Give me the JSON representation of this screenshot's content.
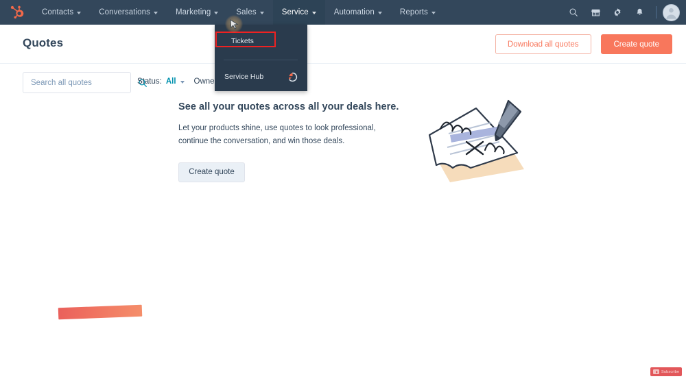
{
  "topnav": {
    "logo_name": "hubspot-sprocket-logo",
    "items": [
      {
        "label": "Contacts",
        "has_caret": true,
        "active": false
      },
      {
        "label": "Conversations",
        "has_caret": true,
        "active": false
      },
      {
        "label": "Marketing",
        "has_caret": true,
        "active": false
      },
      {
        "label": "Sales",
        "has_caret": true,
        "active": false
      },
      {
        "label": "Service",
        "has_caret": true,
        "active": true
      },
      {
        "label": "Automation",
        "has_caret": true,
        "active": false
      },
      {
        "label": "Reports",
        "has_caret": true,
        "active": false
      }
    ],
    "icons": [
      "search-icon",
      "marketplace-icon",
      "settings-gear-icon",
      "notifications-bell-icon"
    ],
    "avatar_name": "user-avatar",
    "background_color": "#33475b",
    "active_background_color": "#2d4356"
  },
  "dropdown": {
    "open_for": "Service",
    "tickets_label": "Tickets",
    "service_hub_label": "Service Hub",
    "service_hub_icon": "service-hub-icon",
    "highlight_color": "#ee2222",
    "background_color": "#2a3b4d"
  },
  "header": {
    "title": "Quotes",
    "download_label": "Download all quotes",
    "create_label": "Create quote",
    "primary_color": "#f8775c"
  },
  "filters": {
    "search_placeholder": "Search all quotes",
    "search_value": "",
    "status_label": "Status:",
    "status_value": "All",
    "owners_label": "Owners:",
    "link_color": "#0091ae"
  },
  "empty_state": {
    "title": "See all your quotes across all your deals here.",
    "body": "Let your products shine, use quotes to look professional, continue the conversation, and win those deals.",
    "button_label": "Create quote",
    "illustration_name": "signed-contract-with-pen-illustration"
  },
  "annotations": {
    "marker_name": "red-orange-highlight-marker",
    "marker_colors": [
      "#e8544f",
      "#f4865f"
    ]
  },
  "subscribe": {
    "label": "Subscribe",
    "color": "#e2575a"
  }
}
